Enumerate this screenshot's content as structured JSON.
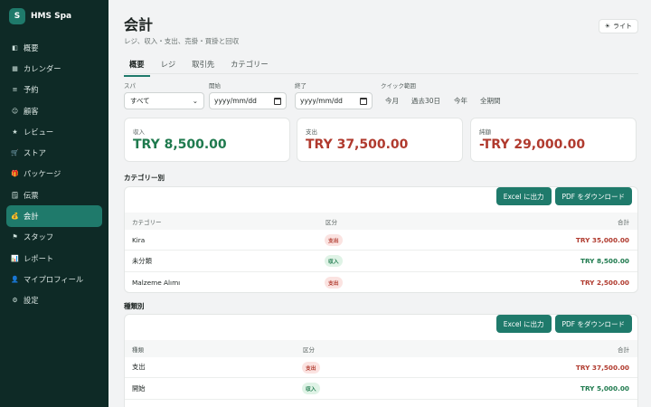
{
  "brand": {
    "logo": "S",
    "name": "HMS Spa"
  },
  "sidebar": {
    "items": [
      {
        "icon": "◧",
        "label": "概要"
      },
      {
        "icon": "▦",
        "label": "カレンダー"
      },
      {
        "icon": "≡",
        "label": "予約"
      },
      {
        "icon": "☺",
        "label": "顧客"
      },
      {
        "icon": "★",
        "label": "レビュー"
      },
      {
        "icon": "🛒",
        "label": "ストア"
      },
      {
        "icon": "🎁",
        "label": "パッケージ"
      },
      {
        "icon": "🗒",
        "label": "伝票"
      },
      {
        "icon": "💰",
        "label": "会計"
      },
      {
        "icon": "⚑",
        "label": "スタッフ"
      },
      {
        "icon": "📊",
        "label": "レポート"
      },
      {
        "icon": "👤",
        "label": "マイプロフィール"
      },
      {
        "icon": "⚙",
        "label": "設定"
      }
    ],
    "active_index": 8
  },
  "header": {
    "title": "会計",
    "subtitle": "レジ、収入・支出、売掛・買掛と回収",
    "theme_label": "ライト",
    "theme_icon": "☀"
  },
  "tabs": [
    "概要",
    "レジ",
    "取引先",
    "カテゴリー"
  ],
  "filters": {
    "spa_label": "スパ",
    "spa_value": "すべて",
    "start_label": "開始",
    "start_placeholder": "yyyy/mm/dd",
    "end_label": "終了",
    "end_placeholder": "yyyy/mm/dd",
    "quick_label": "クイック範囲",
    "quick_options": [
      "今月",
      "過去30日",
      "今年",
      "全期間"
    ]
  },
  "stats": [
    {
      "label": "収入",
      "value": "TRY 8,500.00",
      "tone": "green"
    },
    {
      "label": "支出",
      "value": "TRY 37,500.00",
      "tone": "red"
    },
    {
      "label": "純額",
      "value": "-TRY 29,000.00",
      "tone": "red"
    }
  ],
  "actions": {
    "excel": "Excel に出力",
    "pdf": "PDF をダウンロード"
  },
  "by_category": {
    "title": "カテゴリー別",
    "headers": [
      "カテゴリー",
      "区分",
      "合計"
    ],
    "rows": [
      {
        "name": "Kira",
        "type": "支出",
        "kind": "exp",
        "total": "TRY 35,000.00"
      },
      {
        "name": "未分類",
        "type": "収入",
        "kind": "inc",
        "total": "TRY 8,500.00"
      },
      {
        "name": "Malzeme Alımı",
        "type": "支出",
        "kind": "exp",
        "total": "TRY 2,500.00"
      }
    ]
  },
  "by_kind": {
    "title": "種類別",
    "headers": [
      "種類",
      "区分",
      "合計"
    ],
    "rows": [
      {
        "name": "支出",
        "type": "支出",
        "kind": "exp",
        "total": "TRY 37,500.00"
      },
      {
        "name": "開始",
        "type": "収入",
        "kind": "inc",
        "total": "TRY 5,000.00"
      }
    ]
  },
  "colors": {
    "sidebar": "#0e2a26",
    "accent": "#1f7a6b",
    "income": "#1f7a4e",
    "expense": "#b03a2e"
  }
}
